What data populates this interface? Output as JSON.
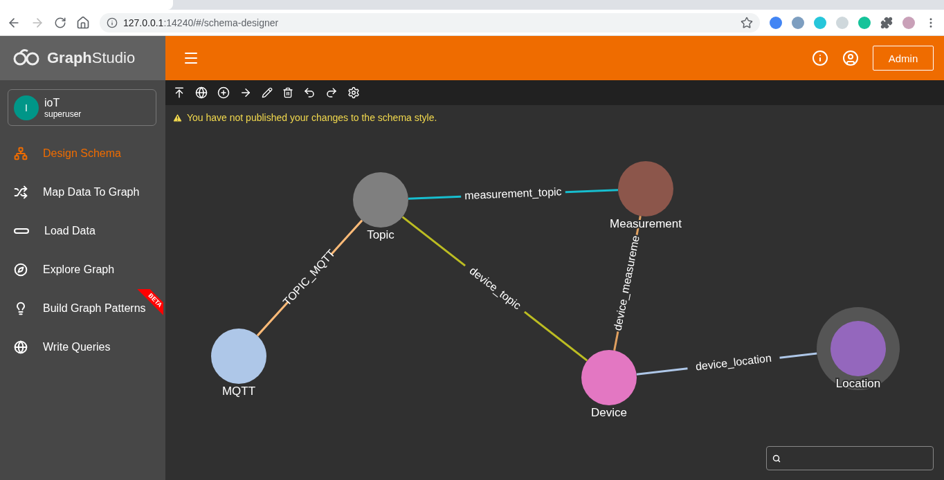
{
  "browser": {
    "url_host": "127.0.0.1",
    "url_rest": ":14240/#/schema-designer"
  },
  "app": {
    "logo": "**Graph**Studio",
    "header": {
      "admin_button": "Admin"
    },
    "user": {
      "initial": "I",
      "name": "ioT",
      "role": "superuser"
    },
    "nav": [
      {
        "label": "Design Schema",
        "selected": true
      },
      {
        "label": "Map Data To Graph",
        "selected": false
      },
      {
        "label": "Load Data",
        "selected": false
      },
      {
        "label": "Explore Graph",
        "selected": false
      },
      {
        "label": "Build Graph Patterns",
        "selected": false,
        "badge": "BETA"
      },
      {
        "label": "Write Queries",
        "selected": false
      }
    ],
    "warning": "You have not published your changes to the schema style.",
    "graph": {
      "nodes": [
        {
          "label": "Topic",
          "color": "#7f7f7f",
          "selected": false
        },
        {
          "label": "Measurement",
          "color": "#8c564b",
          "selected": false
        },
        {
          "label": "MQTT",
          "color": "#aec7e8",
          "selected": false
        },
        {
          "label": "Device",
          "color": "#e377c2",
          "selected": false
        },
        {
          "label": "Location",
          "color": "#9467bd",
          "selected": true
        }
      ],
      "edges": [
        {
          "label": "measurement_topic",
          "color": "#17becf"
        },
        {
          "label": "TOPIC_MQTT",
          "color": "#ffbb78"
        },
        {
          "label": "device_topic",
          "color": "#bcbd22"
        },
        {
          "label": "device_measureme",
          "color": "#e0a060"
        },
        {
          "label": "device_location",
          "color": "#aec7e8"
        }
      ]
    }
  }
}
